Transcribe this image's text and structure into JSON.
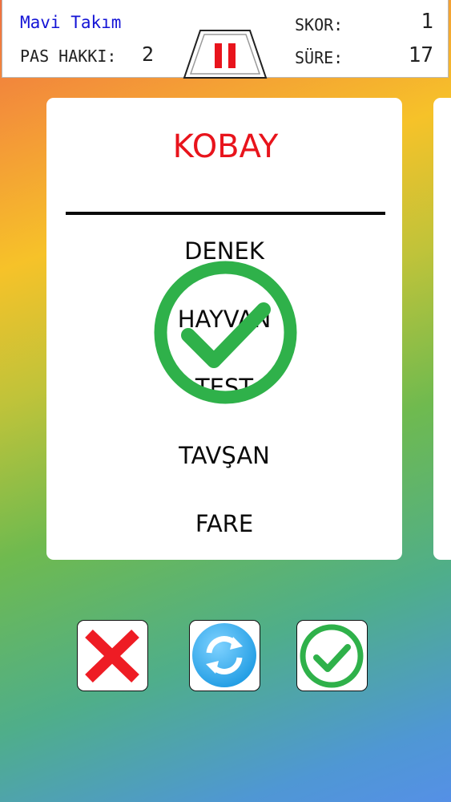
{
  "header": {
    "team_name": "Mavi Takım",
    "pass_label": "PAS HAKKI:",
    "pass_value": "2",
    "score_label": "SKOR:",
    "score_value": "1",
    "time_label": "SÜRE:",
    "time_value": "17"
  },
  "card": {
    "main_word": "KOBAY",
    "taboo_words": [
      "DENEK",
      "HAYVAN",
      "TEST",
      "TAVŞAN",
      "FARE"
    ]
  },
  "icons": {
    "pause": "pause-icon",
    "overlay": "check-circle-icon",
    "wrong": "x-icon",
    "skip": "refresh-icon",
    "correct": "check-icon"
  },
  "colors": {
    "team_text": "#1414d6",
    "main_word": "#e8141c",
    "pause": "#e8141c",
    "check_green": "#2fb14a",
    "wrong_red": "#ee1c24",
    "skip_blue": "#2aa6e8"
  }
}
